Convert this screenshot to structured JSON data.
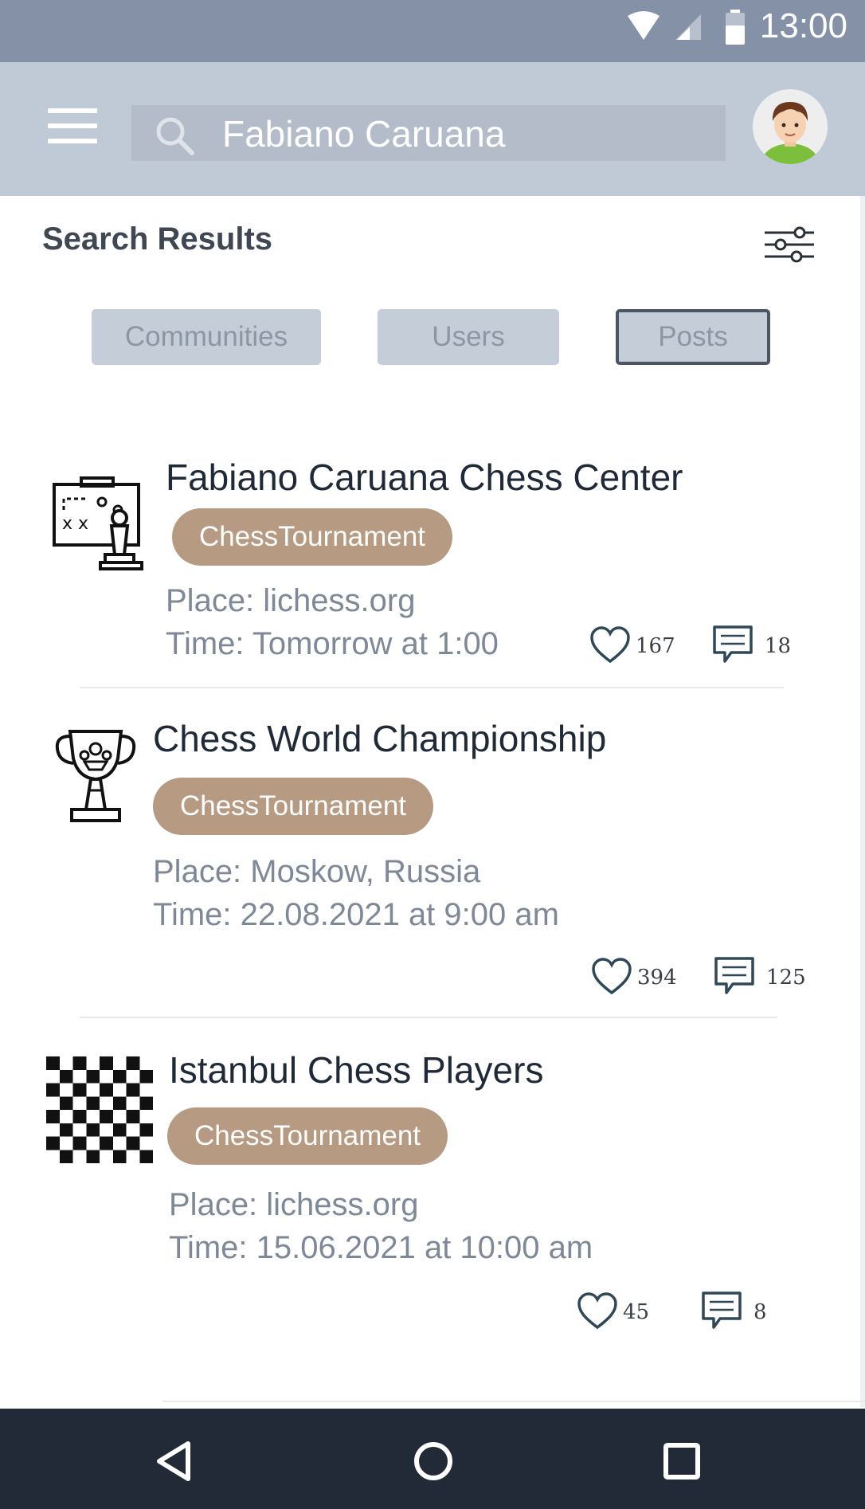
{
  "status_bar": {
    "time": "13:00"
  },
  "search": {
    "query": "Fabiano Caruana"
  },
  "results": {
    "title": "Search Results"
  },
  "tabs": [
    {
      "label": "Communities",
      "active": false
    },
    {
      "label": "Users",
      "active": false
    },
    {
      "label": "Posts",
      "active": true
    }
  ],
  "posts": [
    {
      "title": "Fabiano Caruana Chess Center",
      "tag": "ChessTournament",
      "place": "Place: lichess.org",
      "time": "Time: Tomorrow at 1:00",
      "likes": "167",
      "comments": "18",
      "icon": "chess-strategy-board-icon"
    },
    {
      "title": "Chess World Championship",
      "tag": "ChessTournament",
      "place": "Place: Moskow, Russia",
      "time": "Time: 22.08.2021 at 9:00 am",
      "likes": "394",
      "comments": "125",
      "icon": "chess-trophy-icon"
    },
    {
      "title": "Istanbul Chess Players",
      "tag": "ChessTournament",
      "place": "Place: lichess.org",
      "time": "Time: 15.06.2021 at 10:00 am",
      "likes": "45",
      "comments": "8",
      "icon": "chessboard-icon"
    }
  ],
  "colors": {
    "status_bar": "#8491a6",
    "app_bar": "#c0c9d6",
    "chip": "#b69a81",
    "nav_bar": "#222a38"
  }
}
